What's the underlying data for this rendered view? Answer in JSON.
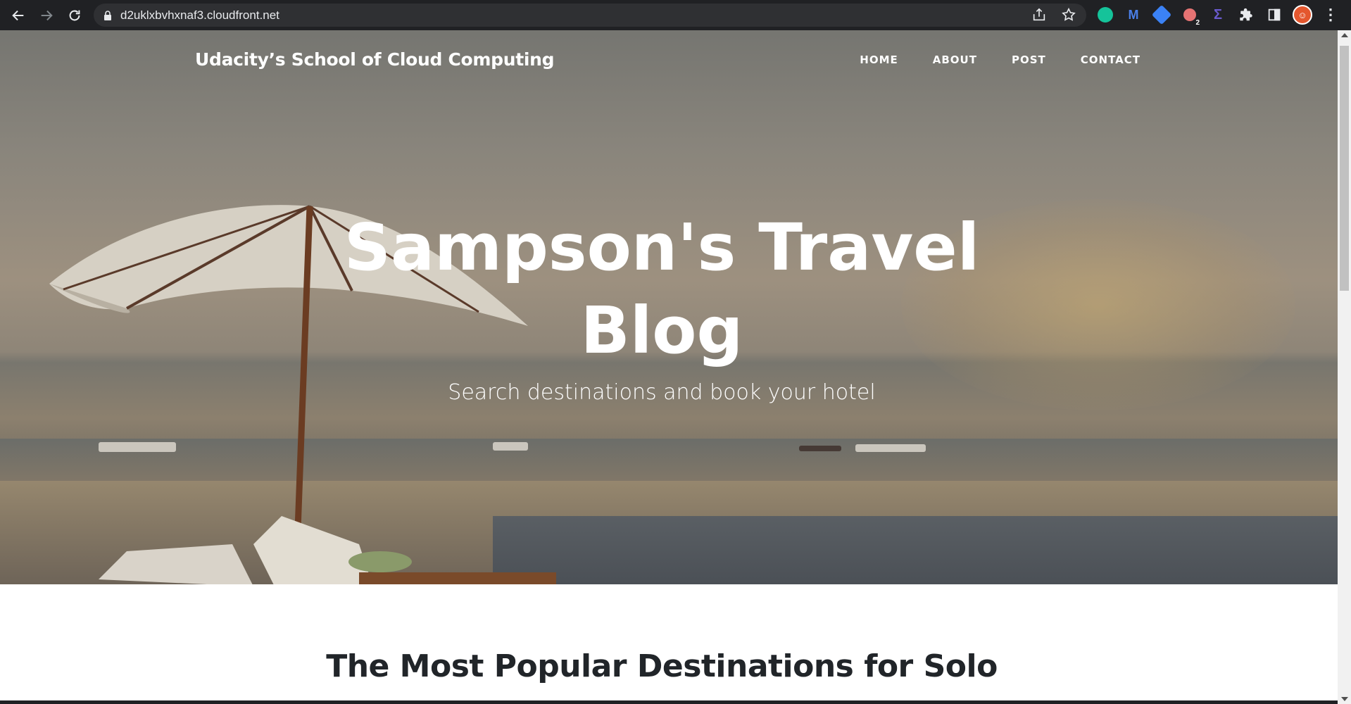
{
  "browser": {
    "url": "d2uklxbvhxnaf3.cloudfront.net",
    "extension_badge": "2"
  },
  "site": {
    "brand": "Udacity’s School of Cloud Computing",
    "nav": [
      "HOME",
      "ABOUT",
      "POST",
      "CONTACT"
    ]
  },
  "hero": {
    "title_line1": "Sampson's Travel",
    "title_line2": "Blog",
    "subtitle": "Search destinations and book your hotel"
  },
  "main": {
    "section_heading": "The Most Popular Destinations for Solo"
  },
  "colors": {
    "chrome_bg": "#202124",
    "omnibox_bg": "#2f3033",
    "hero_text": "#ffffff",
    "heading_text": "#212529"
  }
}
